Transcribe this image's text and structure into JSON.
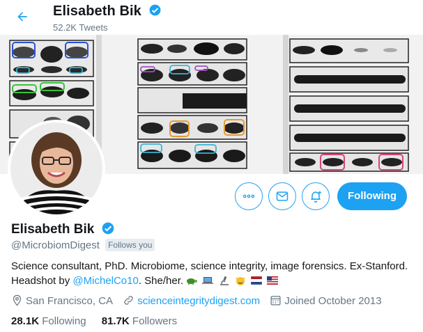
{
  "header": {
    "title": "Elisabeth Bik",
    "subtitle": "52.2K Tweets"
  },
  "profile": {
    "name": "Elisabeth Bik",
    "handle": "@MicrobiomDigest",
    "follows_you": "Follows you",
    "bio_text": "Science consultant, PhD. Microbiome, science integrity, image forensics. Ex-Stanford. Headshot by ",
    "bio_link": "@MichelCo10",
    "bio_tail": ". She/her. ",
    "bio_emojis": [
      "turtle",
      "laptop",
      "microscope",
      "smiling-devil",
      "netherlands-flag",
      "us-flag"
    ],
    "location": "San Francisco, CA",
    "website": "scienceintegritydigest.com",
    "joined": "Joined October 2013"
  },
  "stats": {
    "following_count": "28.1K",
    "following_label": " Following",
    "followers_count": "81.7K",
    "followers_label": " Followers"
  },
  "actions": {
    "follow_label": "Following",
    "more_icon": "more-icon",
    "message_icon": "message-icon",
    "notify_icon": "notification-bell-icon"
  },
  "colors": {
    "accent": "#1da1f2",
    "text": "#14171a",
    "muted": "#657786",
    "verified": "#1da1f2"
  }
}
